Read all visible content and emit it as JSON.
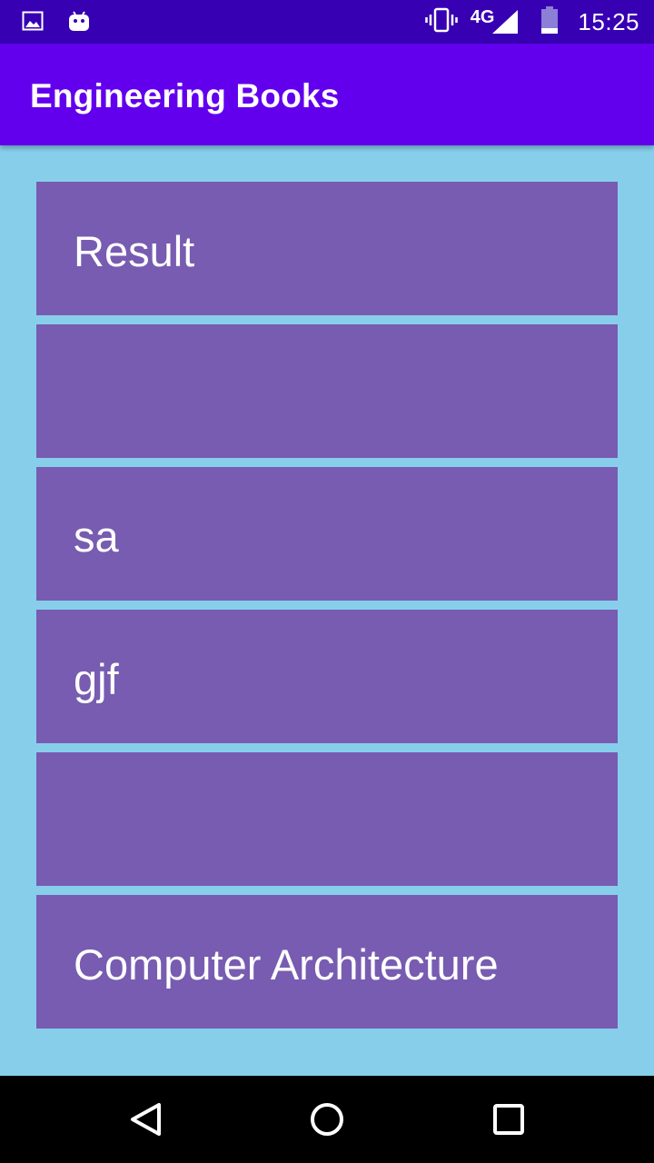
{
  "status_bar": {
    "time": "15:25",
    "network": "4G",
    "icons": [
      "image-icon",
      "android-icon",
      "vibrate-icon",
      "signal-icon",
      "battery-icon"
    ]
  },
  "app_bar": {
    "title": "Engineering Books"
  },
  "books": [
    {
      "title": "Result"
    },
    {
      "title": ""
    },
    {
      "title": "sa"
    },
    {
      "title": "gjf"
    },
    {
      "title": ""
    },
    {
      "title": "Computer Architecture"
    }
  ],
  "nav_bar": {
    "icons": [
      "back-icon",
      "home-icon",
      "recents-icon"
    ]
  },
  "colors": {
    "status_bar": "#3700b3",
    "app_bar": "#6200ee",
    "background": "#87ceeb",
    "item": "#775cb1"
  }
}
